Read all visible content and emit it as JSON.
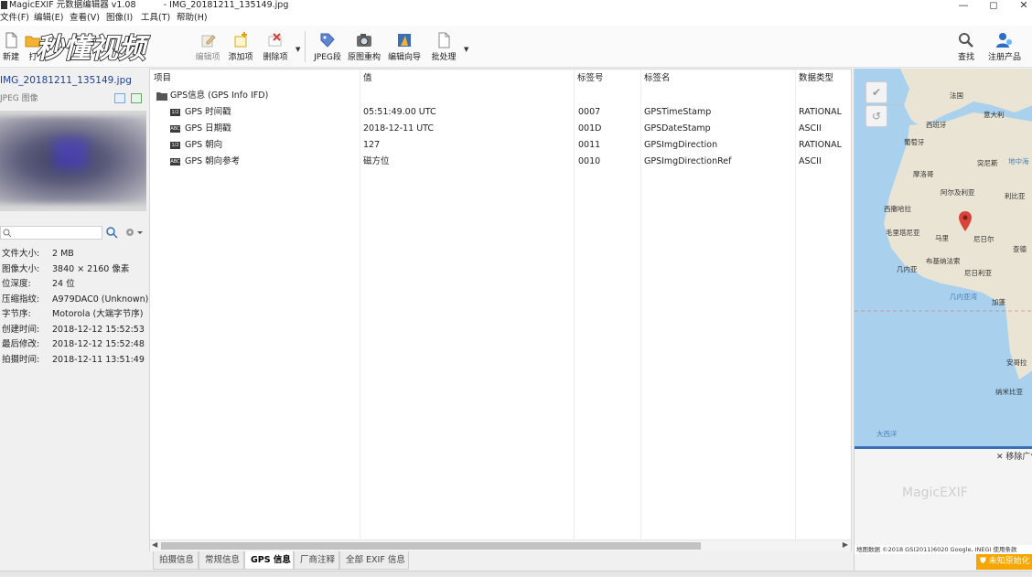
{
  "window": {
    "title": "MagicEXIF 元数据编辑器 v1.08          - IMG_20181211_135149.jpg",
    "minimize": "—",
    "maximize": "◻",
    "close": "✕"
  },
  "menu": [
    "文件(F)",
    "编辑(E)",
    "查看(V)",
    "图像(I)",
    "工具(T)",
    "帮助(H)"
  ],
  "watermark": "秒懂视频",
  "toolbar": {
    "new": "新建",
    "open": "打",
    "edit_item": "编辑项",
    "add_item": "添加项",
    "delete_item": "删除项",
    "jpeg_segment": "JPEG段",
    "rebuild": "原图重构",
    "wizard": "编辑向导",
    "batch": "批处理",
    "search": "查找",
    "register": "注册产品"
  },
  "file": {
    "name": "IMG_20181211_135149.jpg",
    "type": "JPEG 图像"
  },
  "search": {
    "placeholder": ""
  },
  "properties": [
    {
      "k": "文件大小:",
      "v": "2 MB"
    },
    {
      "k": "图像大小:",
      "v": "3840 × 2160 像素"
    },
    {
      "k": "位深度:",
      "v": "24 位"
    },
    {
      "k": "压缩指纹:",
      "v": "A979DAC0 (Unknown)"
    },
    {
      "k": "字节序:",
      "v": "Motorola (大端字节序)"
    },
    {
      "k": "创建时间:",
      "v": "2018-12-12 15:52:53"
    },
    {
      "k": "最后修改:",
      "v": "2018-12-12 15:52:48"
    },
    {
      "k": "拍摄时间:",
      "v": "2018-12-11 13:51:49"
    }
  ],
  "table": {
    "headers": [
      "项目",
      "值",
      "标签号",
      "标签名",
      "数据类型"
    ],
    "group": "GPS信息 (GPS Info IFD)",
    "rows": [
      {
        "item": "GPS 时间戳",
        "value": "05:51:49.00 UTC",
        "tag": "0007",
        "name": "GPSTimeStamp",
        "type": "RATIONAL",
        "icon": "1/2"
      },
      {
        "item": "GPS 日期戳",
        "value": "2018-12-11 UTC",
        "tag": "001D",
        "name": "GPSDateStamp",
        "type": "ASCII",
        "icon": "ABC"
      },
      {
        "item": "GPS 朝向",
        "value": "127",
        "tag": "0011",
        "name": "GPSImgDirection",
        "type": "RATIONAL",
        "icon": "1/2"
      },
      {
        "item": "GPS 朝向参考",
        "value": "磁方位",
        "tag": "0010",
        "name": "GPSImgDirectionRef",
        "type": "ASCII",
        "icon": "ABC"
      }
    ]
  },
  "tabs": [
    "拍摄信息",
    "常规信息",
    "GPS 信息",
    "厂商注释",
    "全部 EXIF 信息"
  ],
  "active_tab": "GPS 信息",
  "map": {
    "labels": {
      "france": "法国",
      "spain": "西班牙",
      "italy": "意大利",
      "portugal": "葡萄牙",
      "mediterranean": "地中海",
      "tunisia": "突尼斯",
      "morocco": "摩洛哥",
      "algeria": "阿尔及利亚",
      "libya": "利比亚",
      "w_sahara": "西撒哈拉",
      "mauritania": "毛里塔尼亚",
      "mali": "马里",
      "niger": "尼日尔",
      "chad": "查德",
      "guinea": "几内亚",
      "burkina": "布基纳法索",
      "nigeria": "尼日利亚",
      "gabon": "加蓬",
      "gulf_guinea": "几内亚湾",
      "angola": "安哥拉",
      "namibia": "纳米比亚",
      "atlantic": "大西洋"
    },
    "footer": "地图数据 ©2018 GS(2011)6020 Google, INEGI   使用条款",
    "ad_close": "✕ 移除广告",
    "ad_text": "MagicEXIF",
    "notice": "未知原始化"
  },
  "colors": {
    "accent": "#1c3f9c",
    "map_water": "#a9d1ee",
    "map_land": "#e9e4d4",
    "marker": "#d9443a",
    "notice": "#f7a600"
  }
}
